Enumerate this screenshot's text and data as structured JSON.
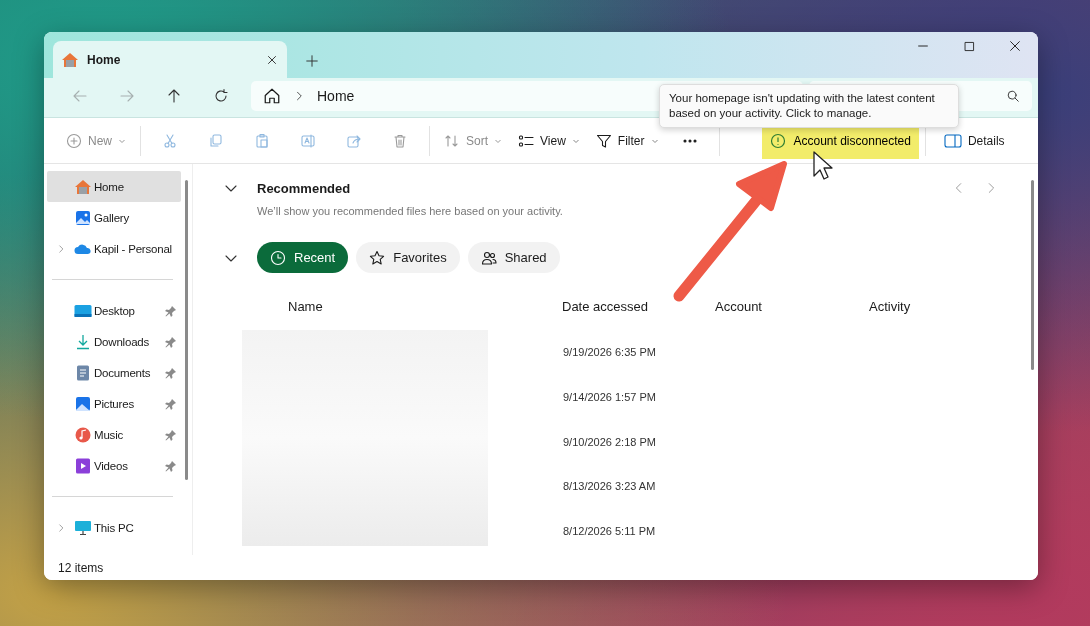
{
  "window": {
    "tab": {
      "title": "Home"
    },
    "address": {
      "crumbs": [
        "Home"
      ]
    }
  },
  "toolbar": {
    "items": [
      {
        "kind": "new",
        "label": "New",
        "disabled": true,
        "dropdown": true
      },
      {
        "kind": "cut",
        "disabled": true
      },
      {
        "kind": "copy",
        "disabled": true
      },
      {
        "kind": "paste",
        "disabled": true
      },
      {
        "kind": "rename",
        "disabled": true
      },
      {
        "kind": "share",
        "disabled": true
      },
      {
        "kind": "delete",
        "disabled": true
      },
      {
        "kind": "sort",
        "label": "Sort",
        "disabled": true,
        "dropdown": true
      },
      {
        "kind": "view",
        "label": "View",
        "disabled": false,
        "dropdown": true
      },
      {
        "kind": "filter",
        "label": "Filter",
        "disabled": false,
        "dropdown": true
      },
      {
        "kind": "more",
        "disabled": false
      }
    ],
    "account": {
      "label": "Account disconnected",
      "highlighted": true
    },
    "details": {
      "label": "Details"
    }
  },
  "tooltip": "Your homepage isn't updating with the latest content based on your activity. Click to manage.",
  "sidebar": {
    "groups": [
      {
        "items": [
          {
            "kind": "home",
            "label": "Home",
            "selected": true,
            "expandable": false
          },
          {
            "kind": "gallery",
            "label": "Gallery",
            "selected": false,
            "expandable": false
          },
          {
            "kind": "cloud",
            "label": "Kapil - Personal",
            "selected": false,
            "expandable": true
          }
        ]
      },
      {
        "items": [
          {
            "kind": "desktop",
            "label": "Desktop",
            "selected": false,
            "pinned": true
          },
          {
            "kind": "downloads",
            "label": "Downloads",
            "selected": false,
            "pinned": true
          },
          {
            "kind": "documents",
            "label": "Documents",
            "selected": false,
            "pinned": true
          },
          {
            "kind": "pictures",
            "label": "Pictures",
            "selected": false,
            "pinned": true
          },
          {
            "kind": "music",
            "label": "Music",
            "selected": false,
            "pinned": true
          },
          {
            "kind": "videos",
            "label": "Videos",
            "selected": false,
            "pinned": true
          }
        ]
      },
      {
        "items": [
          {
            "kind": "pc",
            "label": "This PC",
            "selected": false,
            "expandable": true
          }
        ]
      }
    ]
  },
  "recommended": {
    "title": "Recommended",
    "expanded": true,
    "message": "We’ll show you recommended files here based on your activity."
  },
  "filters": [
    {
      "kind": "recent",
      "label": "Recent",
      "selected": true
    },
    {
      "kind": "favorites",
      "label": "Favorites",
      "selected": false
    },
    {
      "kind": "shared",
      "label": "Shared",
      "selected": false
    }
  ],
  "table": {
    "columns": [
      "Name",
      "Date accessed",
      "Account",
      "Activity"
    ],
    "rows": [
      {
        "date": "9/19/2026 6:35 PM"
      },
      {
        "date": "9/14/2026 1:57 PM"
      },
      {
        "date": "9/10/2026 2:18 PM"
      },
      {
        "date": "8/13/2026 3:23 AM"
      },
      {
        "date": "8/12/2026 5:11 PM"
      }
    ]
  },
  "status_bar": {
    "count": "12 items"
  }
}
